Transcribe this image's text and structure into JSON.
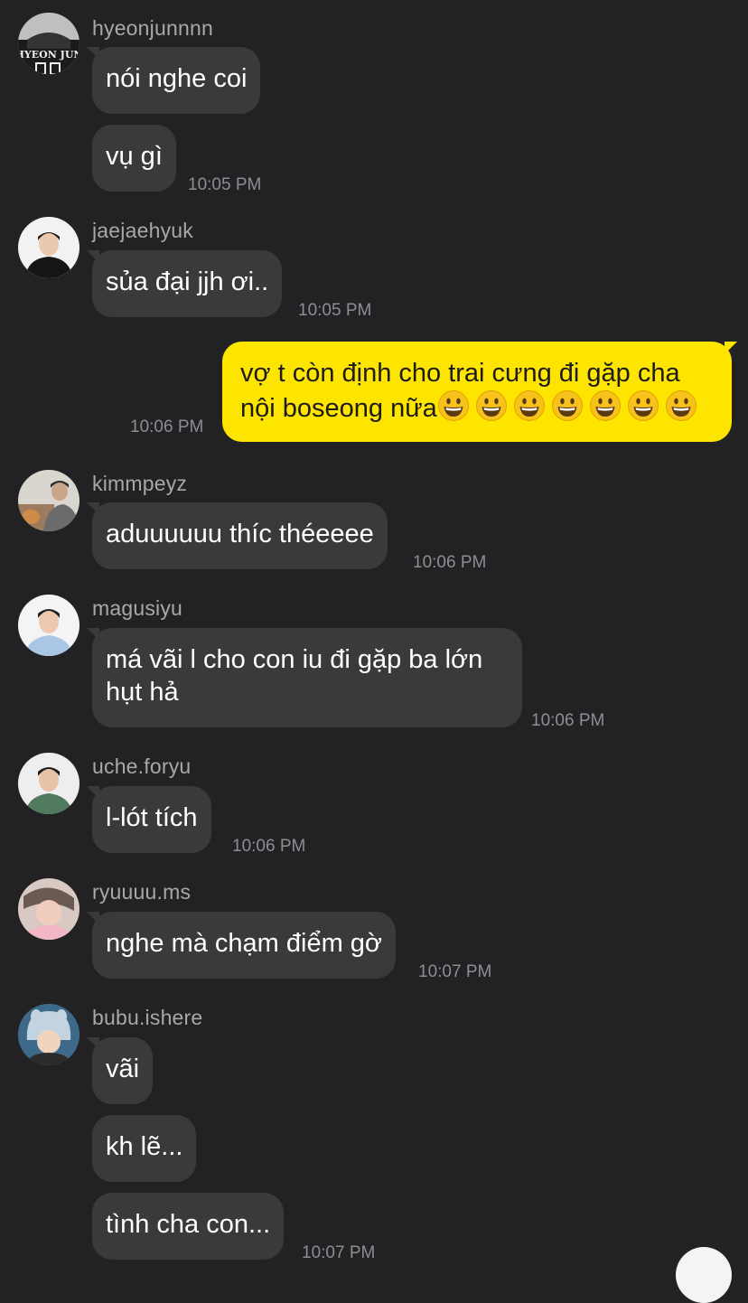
{
  "groups": [
    {
      "sender": "hyeonjunnnn",
      "avatar": "hyeon-jun-jersey-avatar",
      "messages": [
        "nói nghe coi",
        "vụ gì"
      ],
      "time": "10:05 PM"
    },
    {
      "sender": "jaejaehyuk",
      "avatar": "jaejaehyuk-avatar",
      "messages": [
        "sủa đại jjh ơi.."
      ],
      "time": "10:05 PM"
    },
    {
      "sender": "",
      "mine": true,
      "messages": [
        "vợ t còn định cho trai cưng đi gặp cha nội boseong nữa"
      ],
      "emoji": "grinning-face-emoji",
      "emoji_count": 7,
      "time": "10:06 PM"
    },
    {
      "sender": "kimmpeyz",
      "avatar": "kimmpeyz-avatar",
      "messages": [
        "aduuuuuu thíc théeeee"
      ],
      "time": "10:06 PM"
    },
    {
      "sender": "magusiyu",
      "avatar": "magusiyu-avatar",
      "messages": [
        "má vãi l cho con iu đi gặp ba lớn hụt hả"
      ],
      "time": "10:06 PM"
    },
    {
      "sender": "uche.foryu",
      "avatar": "uche-foryu-avatar",
      "messages": [
        "l-lót tích"
      ],
      "time": "10:06 PM"
    },
    {
      "sender": "ryuuuu.ms",
      "avatar": "ryuuuu-ms-avatar",
      "messages": [
        "nghe mà chạm điểm gờ"
      ],
      "time": "10:07 PM"
    },
    {
      "sender": "bubu.ishere",
      "avatar": "bubu-ishere-avatar",
      "messages": [
        "vãi",
        "kh lẽ...",
        "tình cha con..."
      ],
      "time": "10:07 PM"
    }
  ],
  "avatar_text": "HYEON JUN",
  "colors": {
    "background": "#222224",
    "incoming_bubble": "#3a3a3c",
    "outgoing_bubble": "#fee500",
    "sender_text": "#a8a8aa",
    "timestamp_text": "#8e8e92"
  }
}
